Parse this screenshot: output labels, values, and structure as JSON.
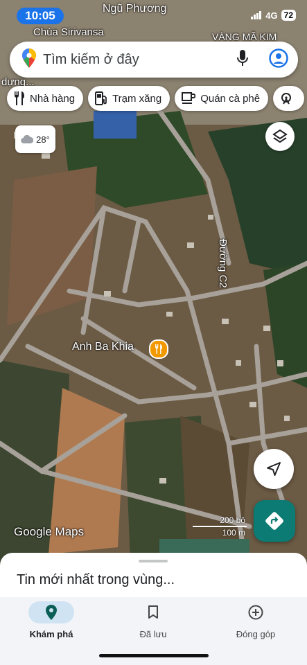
{
  "status_bar": {
    "time": "10:05",
    "network": "4G",
    "battery": "72"
  },
  "map_labels": {
    "top_center": "Ngũ Phương",
    "temple": "Chùa Sirivansa",
    "top_right": "VÀNG MÃ KIM",
    "left_cut": "dựng...",
    "road": "Đường C2"
  },
  "search": {
    "placeholder": "Tìm kiếm ở đây",
    "mic_icon": "microphone-icon",
    "account_icon": "account-circle-icon"
  },
  "chips": [
    {
      "label": "Nhà hàng",
      "icon": "restaurant-icon"
    },
    {
      "label": "Trạm xăng",
      "icon": "gas-station-icon"
    },
    {
      "label": "Quán cà phê",
      "icon": "coffee-icon"
    }
  ],
  "weather": {
    "temperature": "28°",
    "icon": "cloud-icon"
  },
  "poi": {
    "name": "Anh Ba Khia",
    "icon": "restaurant-icon",
    "color": "#f29900"
  },
  "branding": {
    "label": "Google Maps"
  },
  "scale": {
    "feet": "200 bộ",
    "meters": "100 m"
  },
  "sheet": {
    "title": "Tin mới nhất trong vùng..."
  },
  "nav": [
    {
      "label": "Khám phá",
      "icon": "explore-pin-icon",
      "active": true
    },
    {
      "label": "Đã lưu",
      "icon": "bookmark-icon",
      "active": false
    },
    {
      "label": "Đóng góp",
      "icon": "add-circle-icon",
      "active": false
    }
  ],
  "colors": {
    "accent": "#1a73e8",
    "directions": "#0b7b73",
    "active_pill": "#cfe3f3"
  }
}
